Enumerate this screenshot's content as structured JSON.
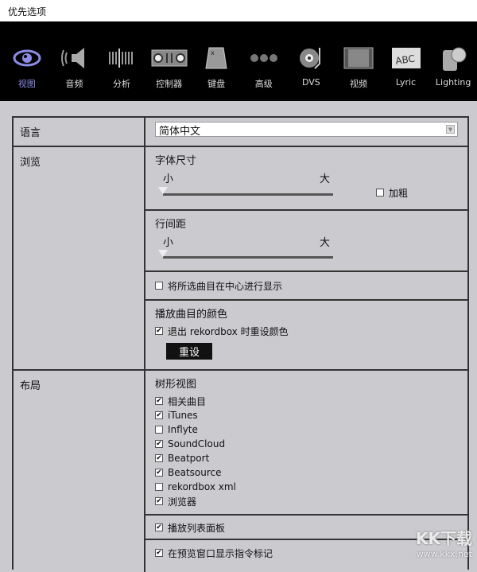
{
  "window": {
    "title": "优先选项"
  },
  "toolbar": [
    {
      "label": "视图",
      "icon": "eye-icon",
      "active": true
    },
    {
      "label": "音频",
      "icon": "speaker-icon"
    },
    {
      "label": "分析",
      "icon": "waveform-icon"
    },
    {
      "label": "控制器",
      "icon": "controller-icon"
    },
    {
      "label": "键盘",
      "icon": "keyboard-key-icon"
    },
    {
      "label": "高级",
      "icon": "more-dots-icon"
    },
    {
      "label": "DVS",
      "icon": "turntable-icon"
    },
    {
      "label": "视频",
      "icon": "film-icon"
    },
    {
      "label": "Lyric",
      "icon": "abc-icon"
    },
    {
      "label": "Lighting",
      "icon": "lighting-icon"
    }
  ],
  "language": {
    "label": "语言",
    "value": "简体中文"
  },
  "browse": {
    "label": "浏览",
    "font_size": {
      "title": "字体尺寸",
      "min": "小",
      "max": "大",
      "value": 0,
      "bold_label": "加粗",
      "bold": false
    },
    "line_spacing": {
      "title": "行间距",
      "min": "小",
      "max": "大",
      "value": 0
    },
    "center_label": "将所选曲目在中心进行显示",
    "center": false,
    "colors": {
      "title": "播放曲目的颜色",
      "reset_on_exit_label": "退出 rekordbox 时重设颜色",
      "reset_on_exit": true,
      "reset_button": "重设"
    }
  },
  "layout": {
    "label": "布局",
    "tree_title": "树形视图",
    "tree_items": [
      {
        "label": "相关曲目",
        "checked": true
      },
      {
        "label": "iTunes",
        "checked": true
      },
      {
        "label": "Inflyte",
        "checked": false
      },
      {
        "label": "SoundCloud",
        "checked": true
      },
      {
        "label": "Beatport",
        "checked": true
      },
      {
        "label": "Beatsource",
        "checked": true
      },
      {
        "label": "rekordbox xml",
        "checked": false
      },
      {
        "label": "浏览器",
        "checked": true
      }
    ],
    "playlist_panel_label": "播放列表面板",
    "playlist_panel": true,
    "preview_marks_label": "在预览窗口显示指令标记",
    "preview_marks": true
  },
  "watermark": {
    "logo": "KK下载",
    "url": "www.kkx.net"
  }
}
